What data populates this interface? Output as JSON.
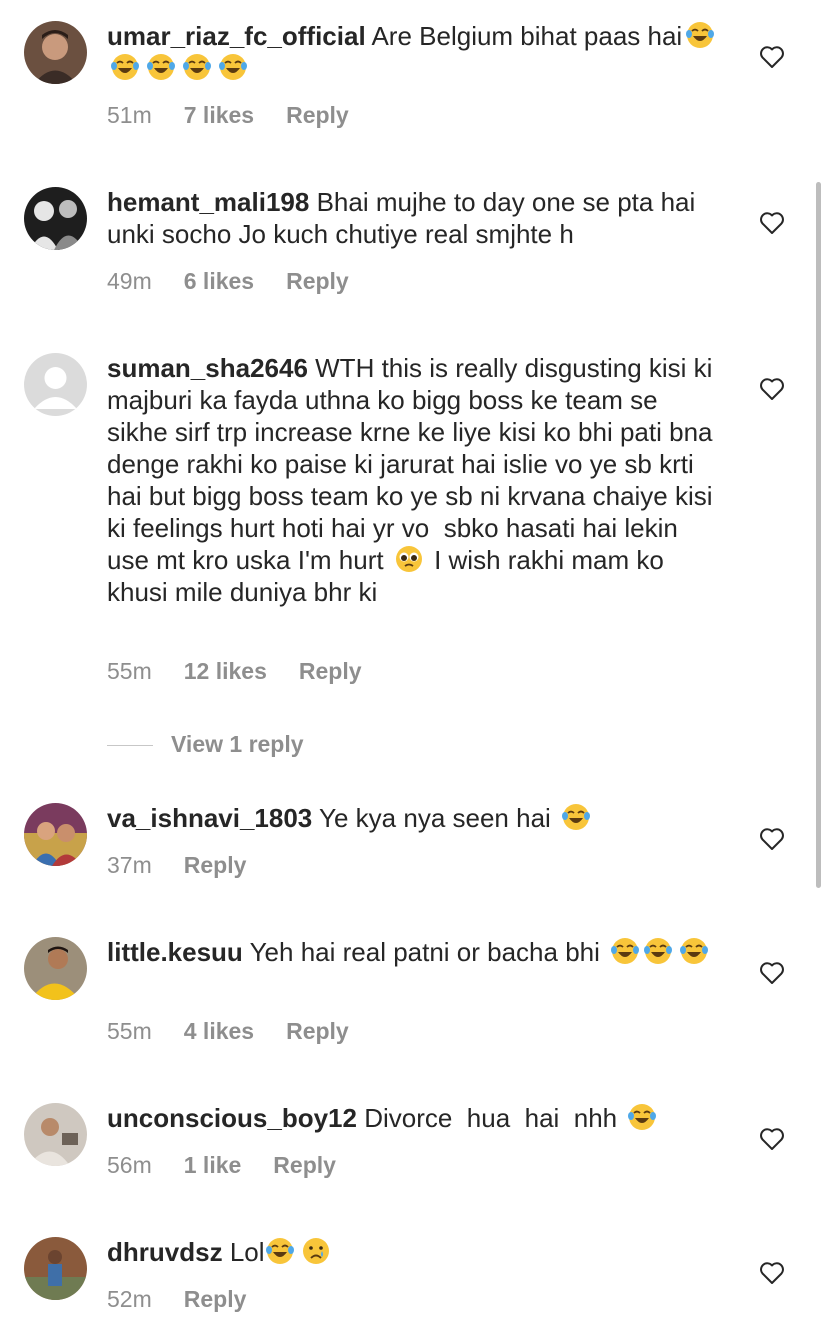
{
  "comments": [
    {
      "username": "umar_riaz_fc_official",
      "text": "Are Belgium bihat paas hai",
      "emoji_after": [
        "laughing-tears",
        "laughing-tears",
        "laughing-tears",
        "laughing-tears",
        "laughing-tears"
      ],
      "time": "51m",
      "likes": "7 likes",
      "reply": "Reply"
    },
    {
      "username": "hemant_mali198",
      "text": "Bhai mujhe to day one se pta hai unki socho Jo kuch chutiye real smjhte h",
      "time": "49m",
      "likes": "6 likes",
      "reply": "Reply"
    },
    {
      "username": "suman_sha2646",
      "text_part1": "WTH this is really disgusting kisi ki majburi ka fayda uthna ko bigg boss ke team se sikhe sirf trp increase krne ke liye kisi ko bhi pati bna denge rakhi ko paise ki jarurat hai islie vo ye sb krti hai but bigg boss team ko ye sb ni krvana chaiye kisi ki feelings hurt hoti hai yr vo  sbko hasati hai lekin use mt kro uska I'm hurt",
      "emoji_mid": "pleading-face",
      "text_part2": " I wish rakhi mam ko khusi mile duniya bhr ki",
      "time": "55m",
      "likes": "12 likes",
      "reply": "Reply",
      "view_replies": "View 1 reply"
    },
    {
      "username": "va_ishnavi_1803",
      "text": "Ye kya nya seen hai",
      "emoji_after": [
        "laughing-tears"
      ],
      "time": "37m",
      "reply": "Reply"
    },
    {
      "username": "little.kesuu",
      "text": "Yeh hai real patni or bacha bhi",
      "emoji_after": [
        "laughing-tears",
        "laughing-tears",
        "laughing-tears"
      ],
      "time": "55m",
      "likes": "4 likes",
      "reply": "Reply"
    },
    {
      "username": "unconscious_boy12",
      "text": "Divorce  hua  hai  nhh",
      "emoji_after": [
        "laughing-tears"
      ],
      "time": "56m",
      "likes": "1 like",
      "reply": "Reply"
    },
    {
      "username": "dhruvdsz",
      "text": "Lol",
      "emoji_after": [
        "laughing-tears",
        "crying-face"
      ],
      "time": "52m",
      "reply": "Reply"
    }
  ],
  "colors": {
    "text": "#262626",
    "secondary": "#8e8e8e",
    "emoji": "#f8c53a"
  }
}
